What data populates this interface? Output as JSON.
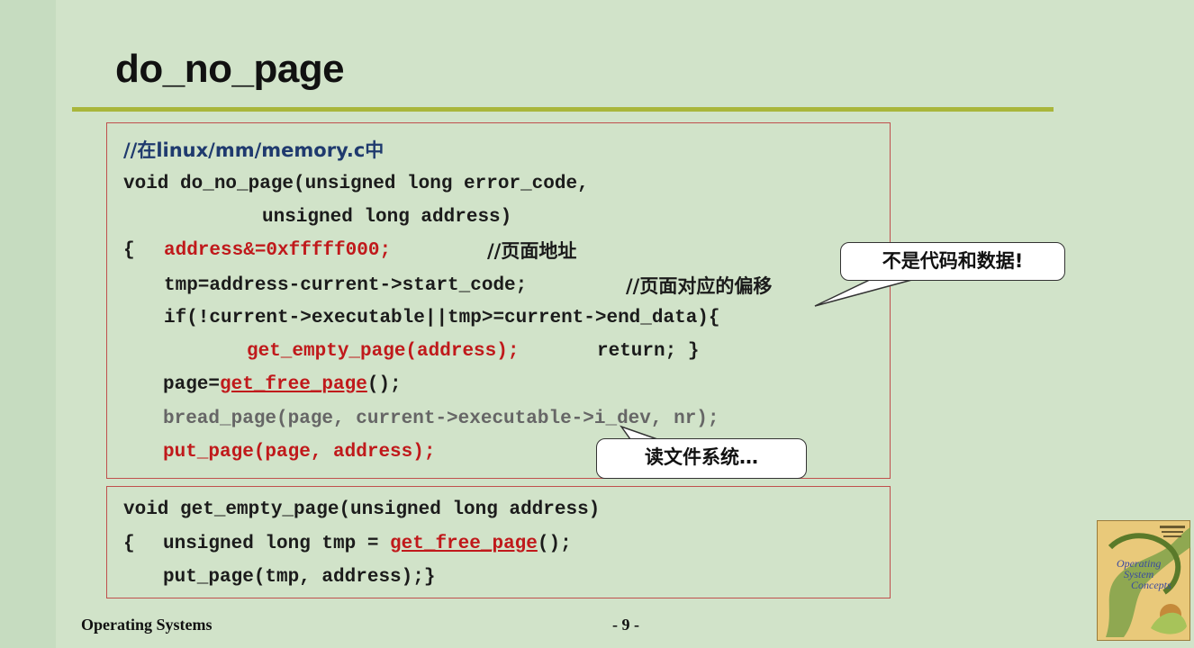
{
  "slide": {
    "title": "do_no_page"
  },
  "code_block_1": {
    "comment": "//在linux/mm/memory.c中",
    "sig_line_1": "void do_no_page(unsigned long error_code,",
    "sig_line_2": "unsigned long address)",
    "brace_open": "{",
    "addr_stmt": "address&=0xfffff000;",
    "addr_comment": "//页面地址",
    "tmp_stmt": "tmp=address-current->start_code;",
    "tmp_comment": "//页面对应的偏移",
    "if_stmt": "if(!current->executable||tmp>=current->end_data){",
    "get_empty_call": "get_empty_page(address);",
    "return_stmt": "return; }",
    "page_assign": "page=",
    "get_free_page": "get_free_page",
    "call_end": "();",
    "bread_stmt": "bread_page(page, current->executable->i_dev, nr);",
    "put_page_stmt": "put_page(page, address);"
  },
  "code_block_2": {
    "sig": "void get_empty_page(unsigned long address)",
    "brace_open": "{",
    "decl": "unsigned long tmp = ",
    "get_free_page": "get_free_page",
    "call_end": "();",
    "put_page_stmt": "put_page(tmp, address);}"
  },
  "callouts": {
    "not_code_data": "不是代码和数据!",
    "read_fs": "读文件系统…"
  },
  "footer": {
    "left": "Operating Systems",
    "page": "- 9 -"
  },
  "book_cover": {
    "title_line_1": "Operating",
    "title_line_2": "System",
    "title_line_3": "Concepts"
  },
  "colors": {
    "background": "#d1e3c9",
    "rule": "#a9b63b",
    "box_border": "#c0504d",
    "code_red": "#c0191b",
    "comment_navy": "#1f3a6e"
  }
}
